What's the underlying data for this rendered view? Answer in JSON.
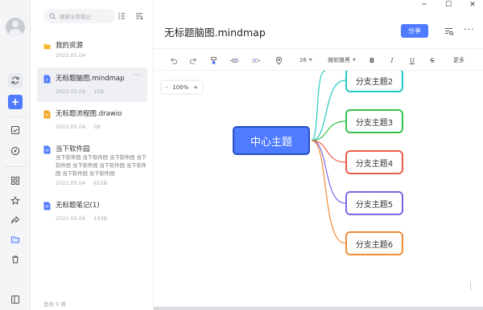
{
  "window": {
    "minimize": "─",
    "maximize": "☐",
    "close": "✕"
  },
  "notes_list": {
    "search_placeholder": "搜索全部笔记",
    "items": [
      {
        "title": "我的资源",
        "date": "2022.05.04",
        "size": "",
        "icon": "folder-icon"
      },
      {
        "title": "无标题脑图.mindmap",
        "date": "2022.05.04",
        "size": "1KB",
        "icon": "mindmap-file-icon",
        "more": "···"
      },
      {
        "title": "无标题流程图.drawio",
        "date": "2022.05.04",
        "size": "0B",
        "icon": "drawio-file-icon"
      },
      {
        "title": "当下软件园",
        "snippet": "当下软件园 当下软件园 当下软件园 当下软件园 当下软件园 当下软件园 当下软件园 当下软件园 当下软件园",
        "date": "2022.05.04",
        "size": "612B",
        "icon": "note-file-icon"
      },
      {
        "title": "无标题笔记(1)",
        "date": "2022.05.04",
        "size": "143B",
        "icon": "note-file-icon"
      }
    ],
    "footer": "总共 5 项"
  },
  "editor": {
    "title": "无标题脑图.mindmap",
    "share_label": "分享",
    "more_label": "···",
    "toolbar": {
      "font_size": "26",
      "font_family": "微软雅黑",
      "more": "更多"
    },
    "zoom": {
      "minus": "-",
      "level": "100%",
      "plus": "+"
    }
  },
  "mindmap": {
    "center": {
      "label": "中心主题",
      "fill": "#4f7bff",
      "border": "#274fc6"
    },
    "branches": [
      {
        "label": "分支主题2",
        "color": "#26c9c4"
      },
      {
        "label": "分支主题3",
        "color": "#35c24a"
      },
      {
        "label": "分支主题4",
        "color": "#ee5a45"
      },
      {
        "label": "分支主题5",
        "color": "#8063e8"
      },
      {
        "label": "分支主题6",
        "color": "#f08a34"
      }
    ]
  },
  "colors": {
    "accent": "#4f7bff"
  }
}
